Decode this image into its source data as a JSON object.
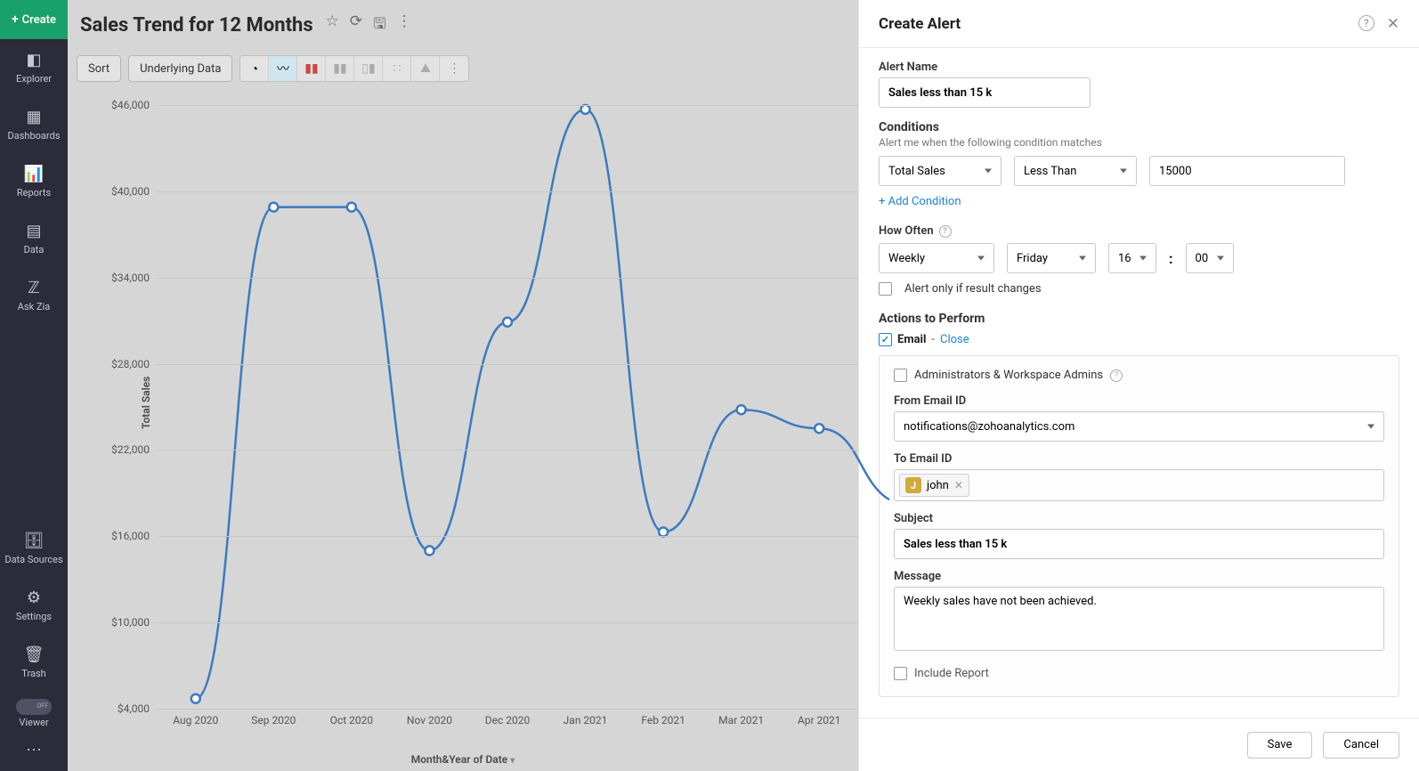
{
  "sidebar": {
    "create": "Create",
    "items": [
      {
        "icon": "explorer-icon",
        "label": "Explorer"
      },
      {
        "icon": "dashboards-icon",
        "label": "Dashboards"
      },
      {
        "icon": "reports-icon",
        "label": "Reports"
      },
      {
        "icon": "data-icon",
        "label": "Data"
      },
      {
        "icon": "ask-zia-icon",
        "label": "Ask Zia"
      }
    ],
    "bottom": [
      {
        "icon": "data-sources-icon",
        "label": "Data Sources"
      },
      {
        "icon": "settings-icon",
        "label": "Settings"
      },
      {
        "icon": "trash-icon",
        "label": "Trash"
      }
    ],
    "viewer": "Viewer"
  },
  "header": {
    "title": "Sales Trend for 12 Months"
  },
  "toolbar": {
    "sort": "Sort",
    "underlying": "Underlying Data"
  },
  "chart_data": {
    "type": "line",
    "title": "Sales Trend for 12 Months",
    "xlabel": "Month&Year of Date",
    "ylabel": "Total Sales",
    "ylim": [
      4000,
      46000
    ],
    "y_ticks": [
      "$4,000",
      "$10,000",
      "$16,000",
      "$22,000",
      "$28,000",
      "$34,000",
      "$40,000",
      "$46,000"
    ],
    "x_ticks": [
      "Aug 2020",
      "Sep 2020",
      "Oct 2020",
      "Nov 2020",
      "Dec 2020",
      "Jan 2021",
      "Feb 2021",
      "Mar 2021",
      "Apr 2021"
    ],
    "values": [
      4700,
      38900,
      38900,
      15000,
      30900,
      45700,
      16300,
      24800,
      23500
    ]
  },
  "panel": {
    "title": "Create Alert",
    "alert_name_label": "Alert Name",
    "alert_name_value": "Sales less than 15 k",
    "conditions_label": "Conditions",
    "conditions_help": "Alert me when the following condition matches",
    "cond_field": "Total Sales",
    "cond_op": "Less Than",
    "cond_value": "15000",
    "add_condition": "+ Add Condition",
    "how_often_label": "How Often",
    "often_period": "Weekly",
    "often_day": "Friday",
    "often_hour": "16",
    "often_min": "00",
    "time_sep": ":",
    "only_if_changes": "Alert only if result changes",
    "actions_label": "Actions to Perform",
    "email_label": "Email",
    "email_dash": "-",
    "close": "Close",
    "admins_label": "Administrators & Workspace Admins",
    "from_label": "From Email ID",
    "from_value": "notifications@zohoanalytics.com",
    "to_label": "To Email ID",
    "to_chip_initial": "J",
    "to_chip_name": "john",
    "subject_label": "Subject",
    "subject_value": "Sales less than 15 k",
    "message_label": "Message",
    "message_value": "Weekly sales have not been achieved.",
    "include_report": "Include Report",
    "save": "Save",
    "cancel": "Cancel"
  }
}
